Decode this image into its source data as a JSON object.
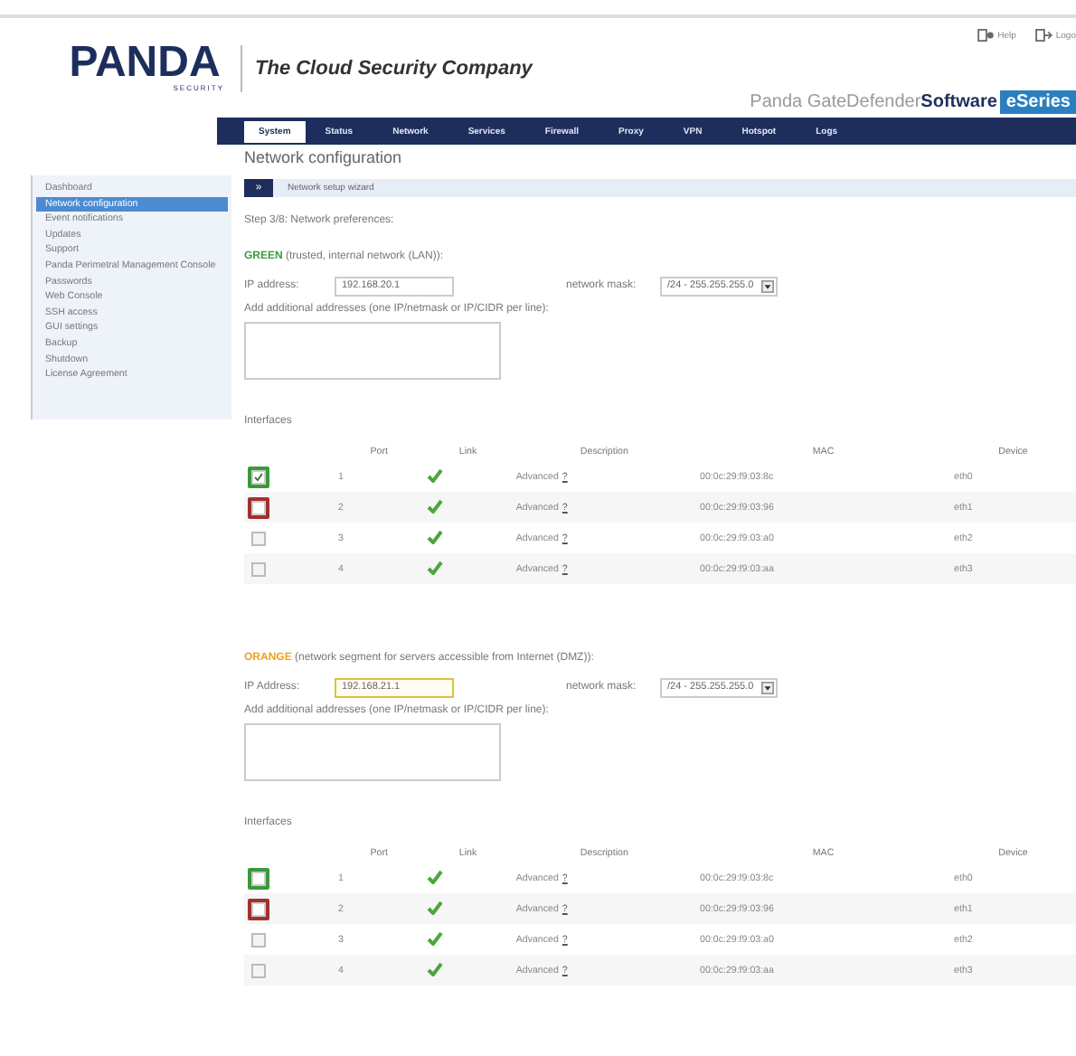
{
  "header": {
    "links": [
      "Help",
      "Logo"
    ],
    "logo": "PANDA",
    "logo_sub": "SECURITY",
    "tagline": "The Cloud Security Company",
    "product": "Panda GateDefender",
    "product_bold": "Software",
    "edition": "eSeries"
  },
  "nav": [
    {
      "label": "System",
      "selected": true
    },
    {
      "label": "Status",
      "selected": false
    },
    {
      "label": "Network",
      "selected": false
    },
    {
      "label": "Services",
      "selected": false
    },
    {
      "label": "Firewall",
      "selected": false
    },
    {
      "label": "Proxy",
      "selected": false
    },
    {
      "label": "VPN",
      "selected": false
    },
    {
      "label": "Hotspot",
      "selected": false
    },
    {
      "label": "Logs",
      "selected": false
    }
  ],
  "sidebar": [
    {
      "label": "Dashboard",
      "selected": false
    },
    {
      "label": "Network configuration",
      "selected": true
    },
    {
      "label": "Event notifications",
      "selected": false
    },
    {
      "label": "Updates",
      "selected": false
    },
    {
      "label": "Support",
      "selected": false
    },
    {
      "label": "Panda Perimetral Management Console",
      "selected": false
    },
    {
      "label": "Passwords",
      "selected": false
    },
    {
      "label": "Web Console",
      "selected": false
    },
    {
      "label": "SSH access",
      "selected": false
    },
    {
      "label": "GUI settings",
      "selected": false
    },
    {
      "label": "Backup",
      "selected": false
    },
    {
      "label": "Shutdown",
      "selected": false
    },
    {
      "label": "License Agreement",
      "selected": false
    }
  ],
  "page_title": "Network configuration",
  "wizard": {
    "button": "»",
    "label": "Network setup wizard"
  },
  "step": "Step 3/8: Network preferences:",
  "zones": [
    {
      "kind": "green",
      "name": "GREEN",
      "description": " (trusted, internal network (LAN)):",
      "ip_label": "IP address:",
      "ip": "192.168.20.1",
      "ip_focused": false,
      "mask_label": "network mask:",
      "mask": "/24 - 255.255.255.0",
      "extra_label": "Add additional addresses (one IP/netmask or IP/CIDR per line):",
      "interfaces_title": "Interfaces",
      "columns": [
        "Port",
        "Link",
        "Description",
        "MAC",
        "Device"
      ],
      "rows": [
        {
          "color": "#3a9a3a",
          "checked": true,
          "port": "1",
          "description": "Advanced",
          "help": "?",
          "mac": "00:0c:29:f9:03:8c",
          "device": "eth0"
        },
        {
          "color": "#a33030",
          "checked": false,
          "port": "2",
          "description": "Advanced",
          "help": "?",
          "mac": "00:0c:29:f9:03:96",
          "device": "eth1"
        },
        {
          "checked": false,
          "port": "3",
          "description": "Advanced",
          "help": "?",
          "mac": "00:0c:29:f9:03:a0",
          "device": "eth2"
        },
        {
          "checked": false,
          "port": "4",
          "description": "Advanced",
          "help": "?",
          "mac": "00:0c:29:f9:03:aa",
          "device": "eth3"
        }
      ]
    },
    {
      "kind": "orange",
      "name": "ORANGE",
      "description": " (network segment for servers accessible from Internet (DMZ)):",
      "ip_label": "IP Address:",
      "ip": "192.168.21.1",
      "ip_focused": true,
      "mask_label": "network mask:",
      "mask": "/24 - 255.255.255.0",
      "extra_label": "Add additional addresses (one IP/netmask or IP/CIDR per line):",
      "interfaces_title": "Interfaces",
      "columns": [
        "Port",
        "Link",
        "Description",
        "MAC",
        "Device"
      ],
      "rows": [
        {
          "color": "#3a9a3a",
          "checked": false,
          "port": "1",
          "description": "Advanced",
          "help": "?",
          "mac": "00:0c:29:f9:03:8c",
          "device": "eth0"
        },
        {
          "color": "#a33030",
          "checked": false,
          "port": "2",
          "description": "Advanced",
          "help": "?",
          "mac": "00:0c:29:f9:03:96",
          "device": "eth1"
        },
        {
          "checked": false,
          "port": "3",
          "description": "Advanced",
          "help": "?",
          "mac": "00:0c:29:f9:03:a0",
          "device": "eth2"
        },
        {
          "checked": false,
          "port": "4",
          "description": "Advanced",
          "help": "?",
          "mac": "00:0c:29:f9:03:aa",
          "device": "eth3"
        }
      ]
    }
  ]
}
